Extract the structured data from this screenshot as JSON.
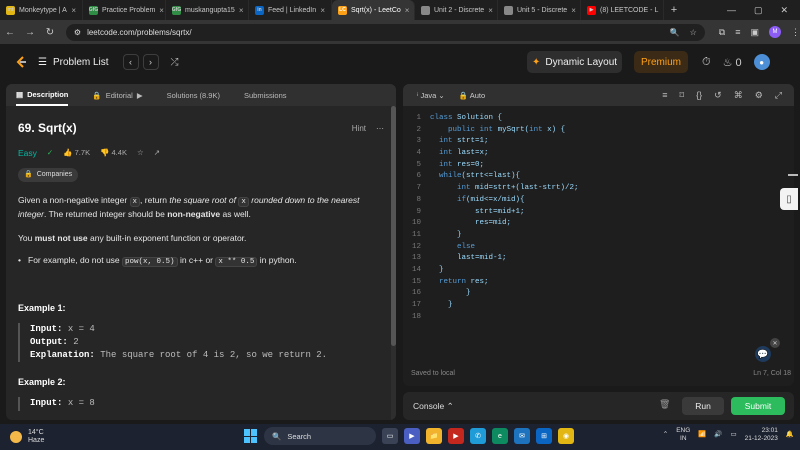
{
  "browser": {
    "tabs": [
      {
        "label": "Monkeytype | A",
        "fav": "mt",
        "favcolor": "#e2b714"
      },
      {
        "label": "Practice Problem",
        "fav": "GfG",
        "favcolor": "#2f8d46"
      },
      {
        "label": "muskangupta15",
        "fav": "GfG",
        "favcolor": "#2f8d46"
      },
      {
        "label": "Feed | LinkedIn",
        "fav": "in",
        "favcolor": "#0a66c2"
      },
      {
        "label": "Sqrt(x) - LeetCo",
        "fav": "LC",
        "favcolor": "#ffa116"
      },
      {
        "label": "Unit 2 - Discrete",
        "fav": "",
        "favcolor": "#888888"
      },
      {
        "label": "Unit 5 - Discrete",
        "fav": "",
        "favcolor": "#888888"
      },
      {
        "label": "(8) LEETCODE - L",
        "fav": "▶",
        "favcolor": "#ff0000"
      }
    ],
    "url": "leetcode.com/problems/sqrtx/"
  },
  "header": {
    "problem_list": "Problem List",
    "dynamic_layout": "Dynamic Layout",
    "premium": "Premium",
    "streak": "0"
  },
  "left_tabs": {
    "description": "Description",
    "editorial": "Editorial",
    "solutions": "Solutions (8.9K)",
    "submissions": "Submissions"
  },
  "problem": {
    "title": "69. Sqrt(x)",
    "hint": "Hint",
    "difficulty": "Easy",
    "likes": "7.7K",
    "dislikes": "4.4K",
    "companies": "Companies",
    "desc1": "Given a non-negative integer",
    "desc_code_x": "x",
    "desc2": ", return",
    "desc3": "the square root of",
    "desc4": "rounded down to the nearest integer",
    "desc5": ". The returned integer should be",
    "desc6": "non-negative",
    "desc7": "as well.",
    "must1": "You",
    "must2": "must not use",
    "must3": "any built-in exponent function or operator.",
    "bullet1": "For example, do not use",
    "bullet_code1": "pow(x, 0.5)",
    "bullet2": "in c++ or",
    "bullet_code2": "x ** 0.5",
    "bullet3": "in python.",
    "example1_title": "Example 1:",
    "example1_input_label": "Input:",
    "example1_input": "x = 4",
    "example1_output_label": "Output:",
    "example1_output": "2",
    "example1_expl_label": "Explanation:",
    "example1_expl": "The square root of 4 is 2, so we return 2.",
    "example2_title": "Example 2:",
    "example2_input_label": "Input:",
    "example2_input": "x = 8"
  },
  "editor": {
    "language": "Java",
    "mode": "Auto",
    "lines": [
      "class Solution {",
      "    public int mySqrt(int x) {",
      "  int strt=1;",
      "  int last=x;",
      "  int res=0;",
      "  while(strt<=last){",
      "      int mid=strt+(last-strt)/2;",
      "      if(mid<=x/mid){",
      "          strt=mid+1;",
      "          res=mid;",
      "      }",
      "      else",
      "      last=mid-1;",
      "  }",
      "  return res;",
      "        }",
      "    }",
      ""
    ],
    "saved": "Saved to local",
    "cursor": "Ln 7, Col 18"
  },
  "console": {
    "label": "Console",
    "run": "Run",
    "submit": "Submit"
  },
  "taskbar": {
    "temp": "14°C",
    "weather": "Haze",
    "search": "Search",
    "lang1": "ENG",
    "lang2": "IN",
    "time": "23:01",
    "date": "21-12-2023"
  }
}
